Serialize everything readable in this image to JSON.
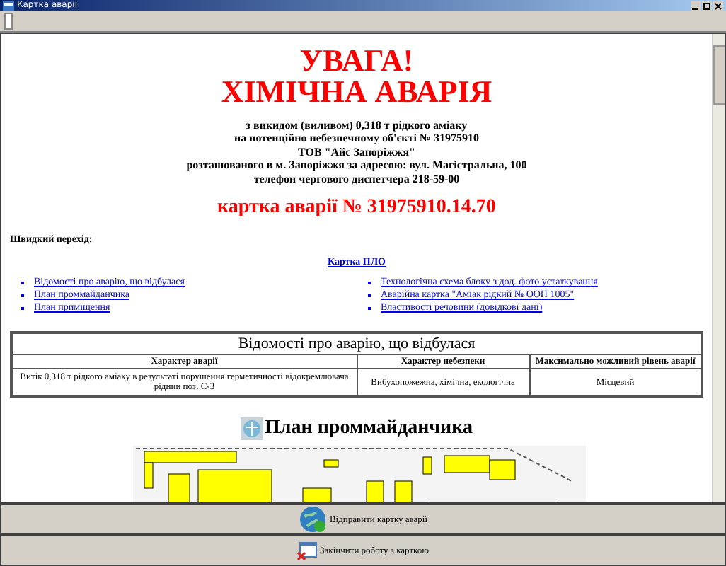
{
  "window": {
    "title": "Картка аварії"
  },
  "alert": {
    "title_lines": [
      "УВАГА!",
      "ХІМІЧНА АВАРІЯ"
    ],
    "details": [
      "з викидом (виливом) 0,318 т рідкого аміаку",
      "на потенційно небезпечному об'єкті № 31975910",
      "ТОВ \"Айс Запоріжжя\"",
      "розташованого в м. Запоріжжя за адресою: вул. Магістральна, 100",
      "телефон чергового диспетчера 218-59-00"
    ],
    "card_number": "картка аварії № 31975910.14.70"
  },
  "quick_nav": {
    "label": "Швидкий перехід:",
    "main_link": "Картка ПЛО",
    "left_links": [
      "Відомості про аварію, що відбулася",
      "План проммайданчика",
      "План приміщення"
    ],
    "right_links": [
      "Технологічна схема блоку з дод. фото устаткування",
      "Аварійна картка \"Аміак рідкий № ООН 1005\"",
      "Властивості речовини (довідкові дані)"
    ]
  },
  "table": {
    "title": "Відомості про аварію, що відбулася",
    "columns": [
      "Характер аварії",
      "Характер небезпеки",
      "Максимально можливий рівень аварії"
    ],
    "rows": [
      [
        "Витік 0,318 т рідкого аміаку в результаті порушення герметичності відокремлювача рідини поз. С-3",
        "Вибухопожежна, хімічна, екологічна",
        "Місцевий"
      ]
    ]
  },
  "plan": {
    "title": "План проммайданчика"
  },
  "buttons": [
    {
      "kind": "send",
      "label": "Відправити картку аварії"
    },
    {
      "kind": "close",
      "label": "Закінчити роботу з карткою"
    }
  ]
}
